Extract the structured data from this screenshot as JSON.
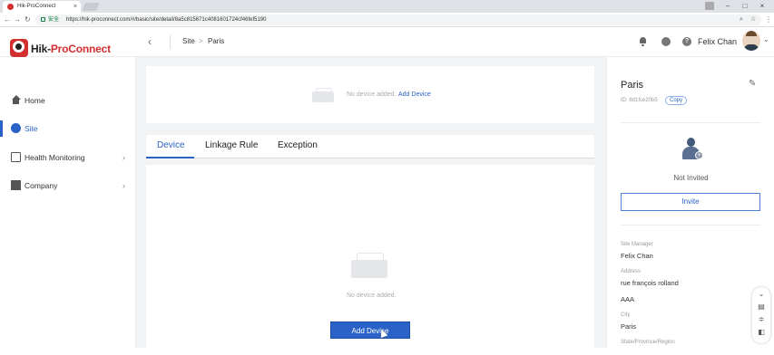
{
  "browser": {
    "tab_title": "Hik-ProConnect",
    "tab_close": "×",
    "secure_label": "安全",
    "url": "https://hik-proconnect.com/#/basic/site/detail/8a5c815671c4081601724cf46fef5190",
    "controls": {
      "minimize": "–",
      "restore": "□",
      "close": "×"
    }
  },
  "header": {
    "logo_prefix": "Hik-",
    "logo_suffix": "ProConnect",
    "logo_badge": "Pro",
    "breadcrumb": {
      "parent": "Site",
      "separator": ">",
      "current": "Paris"
    },
    "help_glyph": "?",
    "user_name": "Felix Chan"
  },
  "sidebar": {
    "items": [
      {
        "label": "Home",
        "icon": "home-icon",
        "has_arrow": false,
        "active": false
      },
      {
        "label": "Site",
        "icon": "globe-icon",
        "has_arrow": false,
        "active": true
      },
      {
        "label": "Health Monitoring",
        "icon": "monitor-icon",
        "has_arrow": true,
        "active": false
      },
      {
        "label": "Company",
        "icon": "building-icon",
        "has_arrow": true,
        "active": false
      }
    ]
  },
  "main": {
    "top_card": {
      "empty_text": "No device added.",
      "add_link": "Add Device"
    },
    "tabs": [
      {
        "label": "Device",
        "active": true
      },
      {
        "label": "Linkage Rule",
        "active": false
      },
      {
        "label": "Exception",
        "active": false
      }
    ],
    "device_card": {
      "empty_text": "No device added.",
      "add_button": "Add Device"
    }
  },
  "right_panel": {
    "site_name": "Paris",
    "site_id": "ID: 8d1fce20b5",
    "copy_label": "Copy",
    "installer_status": "Not Invited",
    "invite_button": "Invite",
    "fields": {
      "site_manager_label": "Site Manager",
      "site_manager_value": "Felix Chan",
      "address_label": "Address",
      "address_line1": "rue françois rolland",
      "address_line2": "AAA",
      "city_label": "City",
      "city_value": "Paris",
      "state_label": "State/Province/Region"
    }
  },
  "colors": {
    "brand_red": "#d32f2f",
    "accent_blue": "#2b62c8",
    "page_bg": "#f2f3f5"
  }
}
